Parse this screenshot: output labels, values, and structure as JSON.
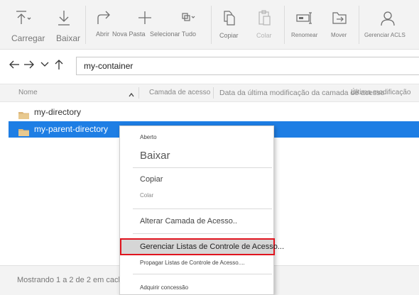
{
  "toolbar": {
    "upload": "Carregar",
    "download": "Baixar",
    "open": "Abrir",
    "new_folder": "Nova Pasta",
    "select_all": "Selecionar Tudo",
    "copy": "Copiar",
    "paste": "Colar",
    "rename": "Renomear",
    "move": "Mover",
    "manage_acls": "Gerenciar ACLS"
  },
  "navigation": {
    "path": "my-container"
  },
  "list": {
    "columns": [
      "Nome",
      "Camada de acesso",
      "Data da última modificação da camada de acesso",
      "Última modificação"
    ],
    "rows": [
      {
        "name": "my-directory",
        "selected": false
      },
      {
        "name": "my-parent-directory",
        "selected": true
      }
    ]
  },
  "status": "Mostrando 1 a 2 de 2 em cache",
  "context_menu": {
    "items": [
      "Aberto",
      "Baixar",
      "Copiar",
      "Colar",
      "Alterar Camada de Acesso..",
      "Gerenciar Listas de Controle de Acesso...",
      "Propagar Listas de Controle de Acesso....",
      "Adquirir concessão"
    ]
  },
  "colors": {
    "selection": "#1e7ee4",
    "highlight_border": "#e0141e",
    "folder": "#dcb67a"
  }
}
